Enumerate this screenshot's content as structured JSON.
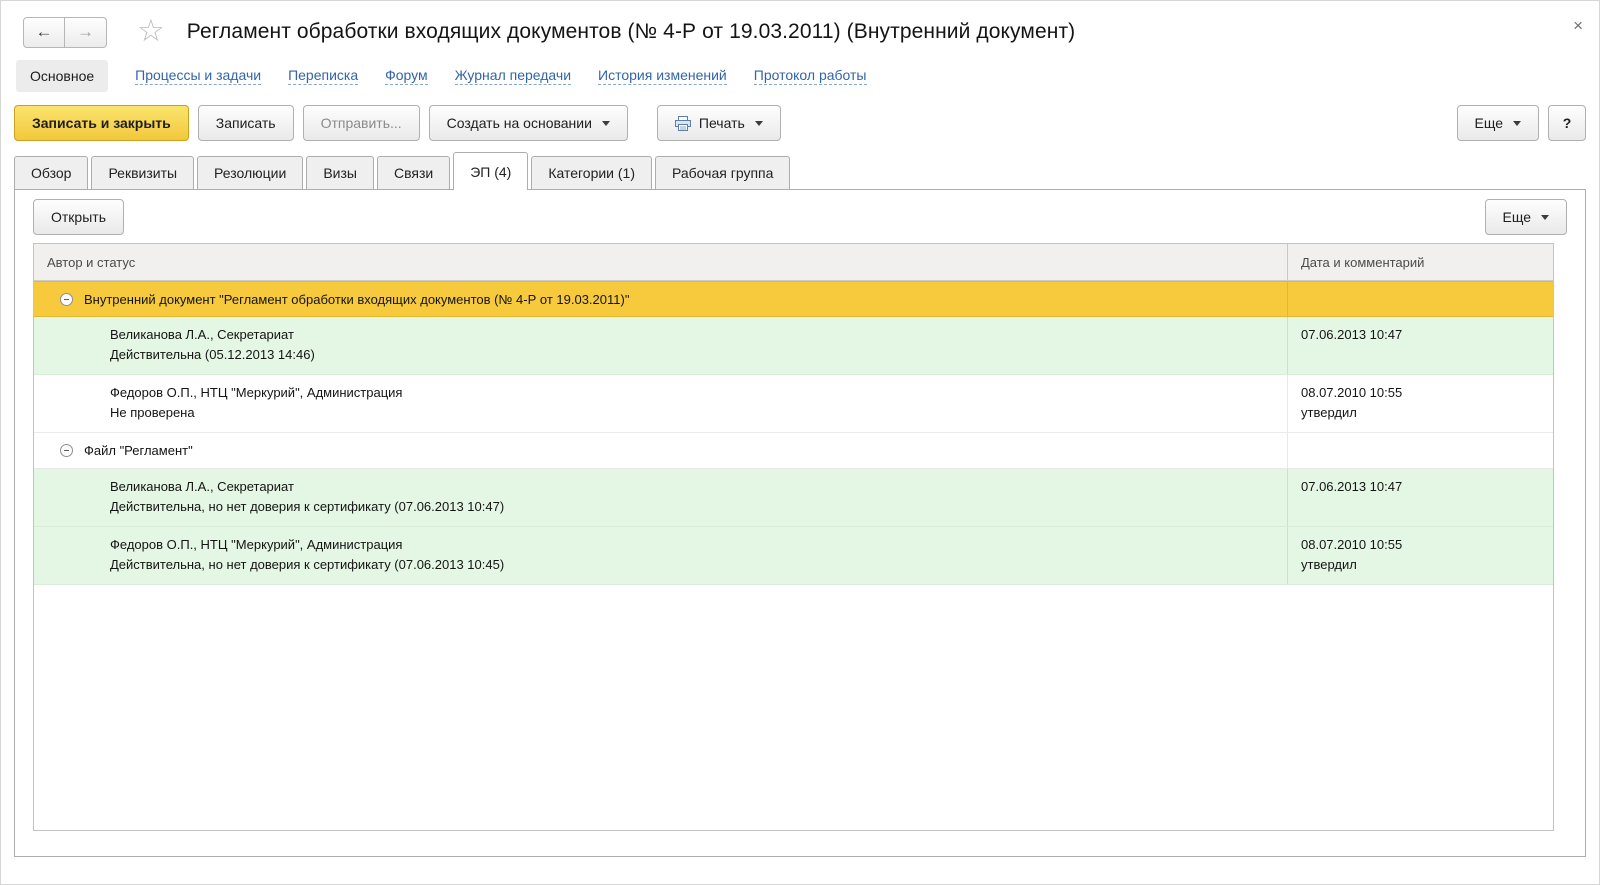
{
  "window": {
    "title": "Регламент обработки входящих документов (№ 4-Р от 19.03.2011) (Внутренний документ)"
  },
  "icons": {
    "back": "←",
    "forward": "→",
    "star": "☆",
    "close": "×"
  },
  "nav": {
    "active": "Основное",
    "links": [
      "Процессы и задачи",
      "Переписка",
      "Форум",
      "Журнал передачи",
      "История изменений",
      "Протокол работы"
    ]
  },
  "toolbar": {
    "save_close": "Записать и закрыть",
    "save": "Записать",
    "send": "Отправить...",
    "create_based": "Создать на основании",
    "print": "Печать",
    "more": "Еще",
    "help": "?"
  },
  "tabs": {
    "items": [
      "Обзор",
      "Реквизиты",
      "Резолюции",
      "Визы",
      "Связи",
      "ЭП (4)",
      "Категории (1)",
      "Рабочая группа"
    ],
    "active_index": 5
  },
  "panel": {
    "open_button": "Открыть",
    "more_button": "Еще"
  },
  "table": {
    "columns": [
      "Автор и статус",
      "Дата и комментарий"
    ],
    "groups": [
      {
        "label": "Внутренний документ \"Регламент обработки входящих документов (№ 4-Р от 19.03.2011)\"",
        "selected": true,
        "rows": [
          {
            "author": "Великанова Л.А., Секретариат",
            "status": "Действительна (05.12.2013 14:46)",
            "date": "07.06.2013 10:47",
            "comment": "",
            "highlight": true
          },
          {
            "author": "Федоров О.П., НТЦ \"Меркурий\", Администрация",
            "status": "Не проверена",
            "date": "08.07.2010 10:55",
            "comment": "утвердил",
            "highlight": false
          }
        ]
      },
      {
        "label": "Файл \"Регламент\"",
        "selected": false,
        "rows": [
          {
            "author": "Великанова Л.А., Секретариат",
            "status": "Действительна, но нет доверия к сертификату (07.06.2013 10:47)",
            "date": "07.06.2013 10:47",
            "comment": "",
            "highlight": true
          },
          {
            "author": "Федоров О.П., НТЦ \"Меркурий\", Администрация",
            "status": "Действительна, но нет доверия к сертификату (07.06.2013 10:45)",
            "date": "08.07.2010 10:55",
            "comment": "утвердил",
            "highlight": true
          }
        ]
      }
    ]
  },
  "colors": {
    "selected_row": "#F7CA3E",
    "valid_row": "#E4F6E4",
    "accent_button": "#F2C83D",
    "link": "#3365A7"
  }
}
